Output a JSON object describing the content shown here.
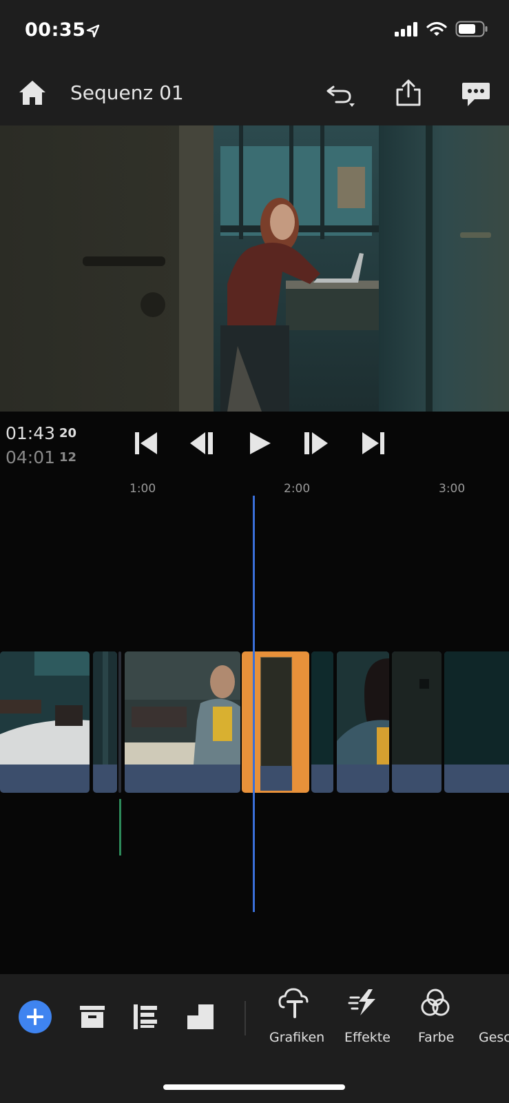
{
  "status": {
    "time": "00:35",
    "icons": [
      "location-arrow-icon",
      "cellular-signal-icon",
      "wifi-icon",
      "battery-icon"
    ]
  },
  "header": {
    "title": "Sequenz 01",
    "buttons": [
      "home-icon",
      "undo-icon",
      "share-icon",
      "comments-icon"
    ]
  },
  "transport": {
    "current_time": "01:43",
    "current_frames": "20",
    "total_time": "04:01",
    "total_frames": "12",
    "buttons": [
      "go-to-start-icon",
      "step-back-icon",
      "play-icon",
      "step-forward-icon",
      "go-to-end-icon"
    ]
  },
  "ruler": {
    "labels": [
      "1:00",
      "2:00",
      "3:00"
    ]
  },
  "toolbar": {
    "left_buttons": [
      "add-icon",
      "archive-icon",
      "align-icon",
      "layers-icon"
    ],
    "tools": [
      {
        "label": "Grafiken",
        "icon": "graphics-icon"
      },
      {
        "label": "Effekte",
        "icon": "effects-icon"
      },
      {
        "label": "Farbe",
        "icon": "color-icon"
      },
      {
        "label": "Gesc",
        "icon": "speed-icon"
      }
    ]
  },
  "colors": {
    "accent": "#3f84f0",
    "playhead": "#3a6fd8",
    "selected_clip": "#e8913a",
    "clip_track": "#3c4e6c",
    "panel_bg": "#1e1e1e",
    "timeline_bg": "#070707"
  }
}
